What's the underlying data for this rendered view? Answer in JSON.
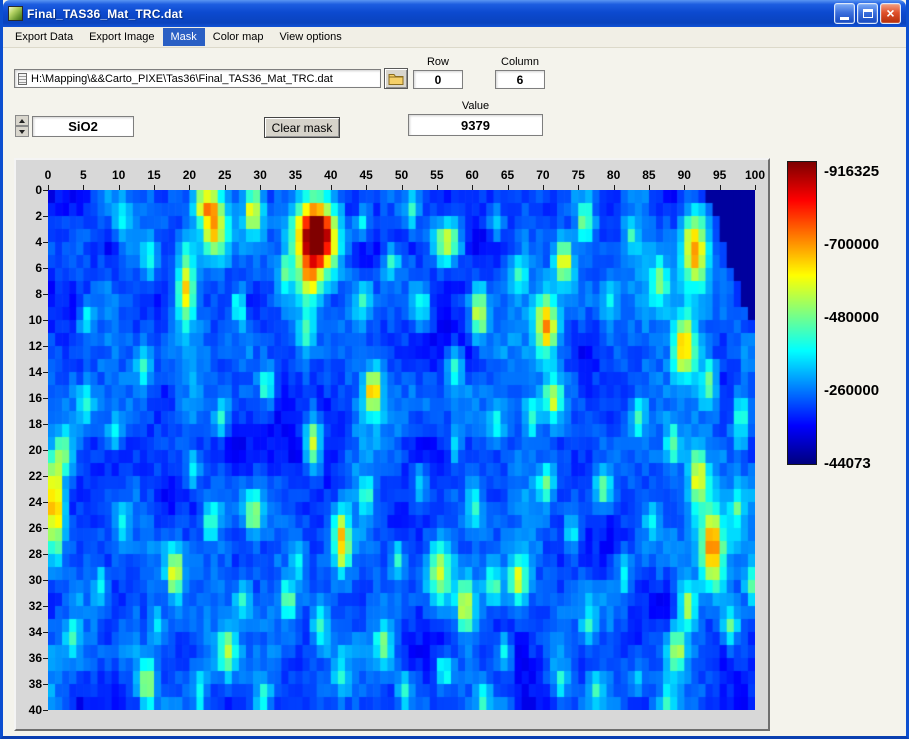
{
  "window": {
    "title": "Final_TAS36_Mat_TRC.dat"
  },
  "menu": {
    "items": [
      {
        "label": "Export Data",
        "selected": false
      },
      {
        "label": "Export Image",
        "selected": false
      },
      {
        "label": "Mask",
        "selected": true
      },
      {
        "label": "Color map",
        "selected": false
      },
      {
        "label": "View options",
        "selected": false
      }
    ]
  },
  "controls": {
    "path_value": "H:\\Mapping\\&&Carto_PIXE\\Tas36\\Final_TAS36_Mat_TRC.dat",
    "row_label": "Row",
    "row_value": "0",
    "column_label": "Column",
    "column_value": "6",
    "element_value": "SiO2",
    "clear_mask_label": "Clear mask",
    "value_label": "Value",
    "value_value": "9379"
  },
  "chart_data": {
    "type": "heatmap",
    "x_ticks": [
      0,
      5,
      10,
      15,
      20,
      25,
      30,
      35,
      40,
      45,
      50,
      55,
      60,
      65,
      70,
      75,
      80,
      85,
      90,
      95,
      100
    ],
    "y_ticks": [
      0,
      2,
      4,
      6,
      8,
      10,
      12,
      14,
      16,
      18,
      20,
      22,
      24,
      26,
      28,
      30,
      32,
      34,
      36,
      38,
      40
    ],
    "x_range": [
      0,
      100
    ],
    "y_range": [
      0,
      40
    ],
    "grid_cols": 100,
    "grid_rows": 40,
    "colormap": "jet",
    "value_min": 44073,
    "value_max": 916325,
    "colorbar_labels": [
      "-916325",
      "-700000",
      "-480000",
      "-260000",
      "-44073"
    ],
    "noise_seed": 7,
    "background_base": 0.12,
    "background_noise": 0.16,
    "background_jitter": 0.07,
    "low_region": {
      "col_start_at_row0": 93,
      "shift_per_row": 0.6,
      "max_row": 9,
      "value": 0.03
    },
    "hotspots": [
      [
        37.5,
        3,
        0.95,
        1.9,
        1.8
      ],
      [
        36.5,
        6.5,
        0.3,
        1.2,
        1.4
      ],
      [
        23,
        2,
        0.5,
        1.3,
        1.8
      ],
      [
        21.5,
        0.5,
        0.3,
        1,
        1
      ],
      [
        28.5,
        1,
        0.45,
        0.9,
        1.3
      ],
      [
        19,
        7,
        0.45,
        0.8,
        2
      ],
      [
        26.5,
        8.5,
        0.3,
        0.7,
        1
      ],
      [
        14,
        5,
        0.18,
        0.8,
        1
      ],
      [
        10,
        2,
        0.18,
        0.7,
        1
      ],
      [
        33,
        6,
        0.22,
        0.7,
        1
      ],
      [
        44,
        2,
        0.22,
        0.7,
        1
      ],
      [
        51,
        1,
        0.2,
        0.7,
        1
      ],
      [
        63,
        2,
        0.2,
        0.7,
        1
      ],
      [
        56,
        3.5,
        0.45,
        1.3,
        1.1
      ],
      [
        48,
        5,
        0.25,
        0.8,
        1
      ],
      [
        60.5,
        9,
        0.42,
        0.8,
        1.3
      ],
      [
        52.5,
        8.5,
        0.22,
        0.7,
        1
      ],
      [
        44,
        8,
        0.22,
        0.7,
        1
      ],
      [
        36,
        10.5,
        0.22,
        0.8,
        1
      ],
      [
        57,
        13,
        0.28,
        0.8,
        1
      ],
      [
        70,
        10,
        0.5,
        1,
        1.5
      ],
      [
        72.5,
        5,
        0.42,
        0.9,
        1.2
      ],
      [
        75.5,
        2,
        0.28,
        0.8,
        1
      ],
      [
        66,
        6,
        0.22,
        0.8,
        1
      ],
      [
        79,
        8,
        0.2,
        0.7,
        1
      ],
      [
        82,
        3,
        0.18,
        0.7,
        1
      ],
      [
        86,
        6.5,
        0.28,
        0.8,
        1.2
      ],
      [
        91,
        4,
        0.5,
        1.2,
        2.2
      ],
      [
        89.5,
        11.5,
        0.48,
        1,
        1.6
      ],
      [
        93,
        14.5,
        0.3,
        0.8,
        1.2
      ],
      [
        83,
        17,
        0.22,
        0.8,
        1
      ],
      [
        88,
        19,
        0.25,
        0.7,
        1
      ],
      [
        97.5,
        17,
        0.28,
        0.7,
        1.3
      ],
      [
        45.5,
        15,
        0.48,
        0.8,
        1.2
      ],
      [
        37,
        19,
        0.42,
        0.8,
        1.4
      ],
      [
        30.5,
        14.5,
        0.28,
        0.8,
        1
      ],
      [
        24,
        17,
        0.22,
        0.7,
        1
      ],
      [
        71,
        15.5,
        0.32,
        0.9,
        1.2
      ],
      [
        63,
        17.5,
        0.2,
        0.7,
        1
      ],
      [
        68,
        17,
        0.18,
        0.7,
        1
      ],
      [
        57,
        19,
        0.18,
        0.7,
        1
      ],
      [
        13,
        13,
        0.2,
        0.8,
        1
      ],
      [
        5,
        9.5,
        0.2,
        0.8,
        1
      ],
      [
        9,
        18,
        0.2,
        0.8,
        1
      ],
      [
        5,
        16,
        0.18,
        0.7,
        1
      ],
      [
        2,
        19.5,
        0.28,
        0.8,
        1.2
      ],
      [
        0.5,
        23.5,
        0.55,
        0.8,
        2.6
      ],
      [
        10,
        25,
        0.18,
        0.7,
        1
      ],
      [
        20,
        21,
        0.2,
        0.7,
        1
      ],
      [
        22.5,
        25,
        0.28,
        0.7,
        1
      ],
      [
        28.5,
        24.5,
        0.32,
        0.8,
        1.2
      ],
      [
        41,
        26.5,
        0.48,
        0.8,
        1.6
      ],
      [
        44.5,
        23,
        0.22,
        0.7,
        1
      ],
      [
        52,
        22,
        0.2,
        0.7,
        1
      ],
      [
        60,
        24,
        0.2,
        0.7,
        1
      ],
      [
        70,
        22,
        0.25,
        0.8,
        1
      ],
      [
        78,
        22.5,
        0.28,
        0.8,
        1
      ],
      [
        85,
        25,
        0.18,
        0.7,
        1
      ],
      [
        91.5,
        21.5,
        0.42,
        0.9,
        1.6
      ],
      [
        93.5,
        27,
        0.55,
        1.1,
        2.2
      ],
      [
        97,
        24,
        0.22,
        0.7,
        1.2
      ],
      [
        99,
        30,
        0.22,
        0.7,
        1.2
      ],
      [
        90,
        31.5,
        0.38,
        0.9,
        1.3
      ],
      [
        88.5,
        35,
        0.32,
        0.9,
        1.2
      ],
      [
        96,
        33,
        0.28,
        0.8,
        1.2
      ],
      [
        17.5,
        29,
        0.42,
        0.8,
        1.3
      ],
      [
        7,
        30,
        0.2,
        0.7,
        1
      ],
      [
        3,
        34,
        0.2,
        0.7,
        1
      ],
      [
        15,
        33,
        0.2,
        0.7,
        1
      ],
      [
        13.5,
        37.5,
        0.38,
        0.8,
        1.2
      ],
      [
        21,
        38,
        0.2,
        0.7,
        1
      ],
      [
        25,
        35,
        0.32,
        0.9,
        1.2
      ],
      [
        27,
        31,
        0.2,
        0.7,
        1
      ],
      [
        33.5,
        31,
        0.25,
        0.8,
        1
      ],
      [
        30,
        38.5,
        0.28,
        0.8,
        1
      ],
      [
        35,
        28,
        0.2,
        0.7,
        1
      ],
      [
        38,
        33,
        0.2,
        0.7,
        1
      ],
      [
        41,
        37,
        0.2,
        0.7,
        1
      ],
      [
        47,
        34.5,
        0.28,
        0.8,
        1
      ],
      [
        49,
        28,
        0.22,
        0.7,
        1
      ],
      [
        50,
        38,
        0.2,
        0.7,
        1
      ],
      [
        55,
        29,
        0.42,
        1.3,
        1.8
      ],
      [
        58.5,
        31.5,
        0.42,
        0.9,
        1.3
      ],
      [
        62.5,
        30,
        0.28,
        0.8,
        1
      ],
      [
        66,
        29.5,
        0.38,
        0.9,
        1.2
      ],
      [
        64,
        35,
        0.22,
        0.8,
        1
      ],
      [
        55.5,
        36.5,
        0.28,
        0.8,
        1
      ],
      [
        61,
        38.5,
        0.2,
        0.7,
        1
      ],
      [
        72,
        37.5,
        0.22,
        0.7,
        1
      ],
      [
        76,
        33,
        0.2,
        0.7,
        1
      ],
      [
        73.5,
        26,
        0.22,
        0.7,
        1
      ],
      [
        81,
        29,
        0.2,
        0.7,
        1
      ],
      [
        83,
        37,
        0.18,
        0.7,
        1
      ],
      [
        87,
        39,
        0.18,
        0.7,
        1
      ],
      [
        77,
        38,
        0.18,
        0.7,
        1
      ]
    ]
  }
}
